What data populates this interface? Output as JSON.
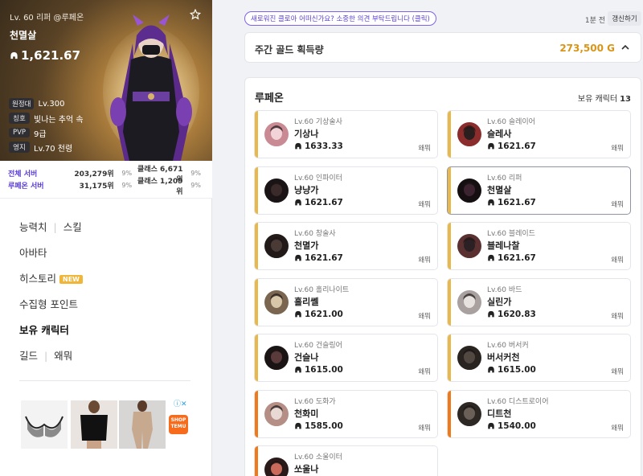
{
  "profile": {
    "subtitle": "Lv. 60 리퍼 @루페온",
    "name": "천멸살",
    "item_level": "1,621.67",
    "stats": [
      {
        "key": "원정대",
        "value": "Lv.300"
      },
      {
        "key": "칭호",
        "value": "빛나는 추억 속"
      },
      {
        "key": "PVP",
        "value": "9급"
      },
      {
        "key": "영지",
        "value": "Lv.70 천령"
      }
    ]
  },
  "ranking": {
    "rows": [
      {
        "label": "전체 서버",
        "rank": "203,279위",
        "pct": "9%",
        "class_rank": "클래스 6,671위",
        "class_pct": "9%"
      },
      {
        "label": "루페온 서버",
        "rank": "31,175위",
        "pct": "9%",
        "class_rank": "클래스 1,209위",
        "class_pct": "9%"
      }
    ]
  },
  "menu": {
    "ability": "능력치",
    "skill": "스킬",
    "avatar": "아바타",
    "history": "히스토리",
    "new_badge": "NEW",
    "collectible": "수집형 포인트",
    "roster": "보유 캐릭터",
    "guild": "길드",
    "guild_name": "왜뭐"
  },
  "topbar": {
    "notice": "새로워진 클로아 어떠신가요? 소중한 의견 부탁드립니다 (클릭)",
    "refresh_time": "1분 전",
    "refresh_button": "갱신하기"
  },
  "gold": {
    "label": "주간 골드 획득량",
    "value": "273,500 G"
  },
  "roster": {
    "server": "루페온",
    "count_label": "보유 캐릭터",
    "count": "13",
    "characters": [
      {
        "lv": "Lv.60 기상술사",
        "name": "기상나",
        "ilvl": "1633.33",
        "guild": "왜뭐",
        "bar": "#e8b84a"
      },
      {
        "lv": "Lv.60 슬레이어",
        "name": "슬레사",
        "ilvl": "1621.67",
        "guild": "왜뭐",
        "bar": "#e8b84a"
      },
      {
        "lv": "Lv.60 인파이터",
        "name": "냥냥가",
        "ilvl": "1621.67",
        "guild": "왜뭐",
        "bar": "#e8b84a"
      },
      {
        "lv": "Lv.60 리퍼",
        "name": "천멸살",
        "ilvl": "1621.67",
        "guild": "왜뭐",
        "bar": "#e8b84a"
      },
      {
        "lv": "Lv.60 창술사",
        "name": "천멸가",
        "ilvl": "1621.67",
        "guild": "왜뭐",
        "bar": "#e8b84a"
      },
      {
        "lv": "Lv.60 블레이드",
        "name": "블레나찰",
        "ilvl": "1621.67",
        "guild": "왜뭐",
        "bar": "#e8b84a"
      },
      {
        "lv": "Lv.60 홀리나이트",
        "name": "홀리쎌",
        "ilvl": "1621.00",
        "guild": "왜뭐",
        "bar": "#e8b84a"
      },
      {
        "lv": "Lv.60 바드",
        "name": "실린가",
        "ilvl": "1620.83",
        "guild": "왜뭐",
        "bar": "#e8b84a"
      },
      {
        "lv": "Lv.60 건슬링어",
        "name": "건슬나",
        "ilvl": "1615.00",
        "guild": "왜뭐",
        "bar": "#e8b84a"
      },
      {
        "lv": "Lv.60 버서커",
        "name": "버서커천",
        "ilvl": "1615.00",
        "guild": "왜뭐",
        "bar": "#e8b84a"
      },
      {
        "lv": "Lv.60 도화가",
        "name": "천화미",
        "ilvl": "1585.00",
        "guild": "왜뭐",
        "bar": "#f07a1a"
      },
      {
        "lv": "Lv.60 디스트로이어",
        "name": "디트천",
        "ilvl": "1540.00",
        "guild": "왜뭐",
        "bar": "#f07a1a"
      },
      {
        "lv": "Lv.60 소울이터",
        "name": "쏘울나",
        "ilvl": "",
        "guild": "",
        "bar": "#f07a1a"
      }
    ]
  },
  "colors": {
    "accent": "#5a3bd6",
    "gold": "#d99517",
    "bar_gold": "#e8b84a",
    "bar_orange": "#f07a1a"
  }
}
